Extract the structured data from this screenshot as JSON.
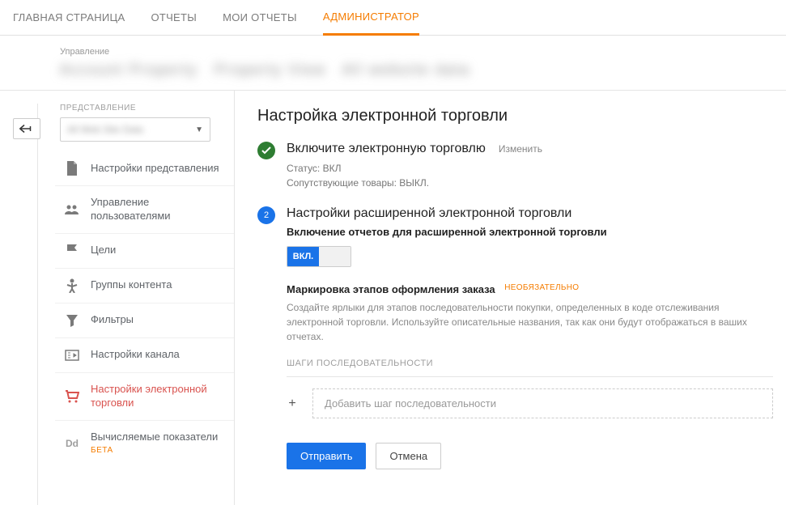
{
  "nav": {
    "tabs": [
      "ГЛАВНАЯ СТРАНИЦА",
      "ОТЧЕТЫ",
      "МОИ ОТЧЕТЫ",
      "АДМИНИСТРАТОР"
    ]
  },
  "admin_header": {
    "management": "Управление"
  },
  "view": {
    "label": "ПРЕДСТАВЛЕНИЕ"
  },
  "sidebar": {
    "items": [
      {
        "label": "Настройки представления"
      },
      {
        "label": "Управление пользователями"
      },
      {
        "label": "Цели"
      },
      {
        "label": "Группы контента"
      },
      {
        "label": "Фильтры"
      },
      {
        "label": "Настройки канала"
      },
      {
        "label": "Настройки электронной торговли"
      },
      {
        "label": "Вычисляемые показатели",
        "beta": "БЕТА"
      }
    ]
  },
  "content": {
    "title": "Настройка электронной торговли",
    "step1": {
      "title": "Включите электронную торговлю",
      "edit": "Изменить",
      "status": "Статус: ВКЛ",
      "related": "Сопутствующие товары: ВЫКЛ."
    },
    "step2": {
      "num": "2",
      "title": "Настройки расширенной электронной торговли",
      "sub": "Включение отчетов для расширенной электронной торговли",
      "toggle_on": "ВКЛ.",
      "label_section": "Маркировка этапов оформления заказа",
      "optional": "НЕОБЯЗАТЕЛЬНО",
      "help": "Создайте ярлыки для этапов последовательности покупки, определенных в коде отслеживания электронной торговли. Используйте описательные названия, так как они будут отображаться в ваших отчетах.",
      "steps_heading": "ШАГИ ПОСЛЕДОВАТЕЛЬНОСТИ",
      "add_step": "Добавить шаг последовательности",
      "submit": "Отправить",
      "cancel": "Отмена"
    }
  }
}
